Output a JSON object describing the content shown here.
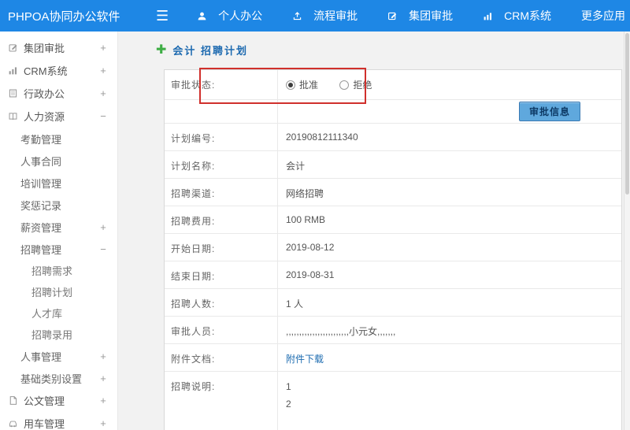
{
  "topbar": {
    "logo": "PHPOA协同办公软件",
    "menu_icon": "☰",
    "nav": [
      {
        "label": "个人办公"
      },
      {
        "label": "流程审批"
      },
      {
        "label": "集团审批"
      },
      {
        "label": "CRM系统"
      },
      {
        "label": "更多应用",
        "caret": "▾"
      }
    ]
  },
  "sidebar": {
    "items": [
      {
        "label": "集团审批",
        "toggle": "+"
      },
      {
        "label": "CRM系统",
        "toggle": "+"
      },
      {
        "label": "行政办公",
        "toggle": "+"
      },
      {
        "label": "人力资源",
        "toggle": "−",
        "children": [
          {
            "label": "考勤管理"
          },
          {
            "label": "人事合同"
          },
          {
            "label": "培训管理"
          },
          {
            "label": "奖惩记录"
          },
          {
            "label": "薪资管理",
            "toggle": "+"
          },
          {
            "label": "招聘管理",
            "toggle": "−",
            "children": [
              {
                "label": "招聘需求"
              },
              {
                "label": "招聘计划"
              },
              {
                "label": "人才库"
              },
              {
                "label": "招聘录用"
              }
            ]
          },
          {
            "label": "人事管理",
            "toggle": "+"
          },
          {
            "label": "基础类别设置",
            "toggle": "+"
          }
        ]
      },
      {
        "label": "公文管理",
        "toggle": "+"
      },
      {
        "label": "用车管理",
        "toggle": "+"
      }
    ]
  },
  "main": {
    "plus_icon": "✚",
    "title": "会计 招聘计划",
    "status_row": {
      "label": "审批状态:",
      "options": [
        {
          "label": "批准",
          "checked": true
        },
        {
          "label": "拒绝",
          "checked": false
        }
      ]
    },
    "approve_button": "审批信息",
    "rows": [
      {
        "label": "计划编号:",
        "value": "20190812111340"
      },
      {
        "label": "计划名称:",
        "value": "会计"
      },
      {
        "label": "招聘渠道:",
        "value": "网络招聘"
      },
      {
        "label": "招聘费用:",
        "value": "100 RMB"
      },
      {
        "label": "开始日期:",
        "value": "2019-08-12"
      },
      {
        "label": "结束日期:",
        "value": "2019-08-31"
      },
      {
        "label": "招聘人数:",
        "value": "1 人"
      },
      {
        "label": "审批人员:",
        "value": ",,,,,,,,,,,,,,,,,,,,,,,,小元女,,,,,,,"
      },
      {
        "label": "附件文档:",
        "link": "附件下载"
      },
      {
        "label": "招聘说明:",
        "lines": [
          "1",
          "2"
        ]
      }
    ]
  },
  "colors": {
    "topbar_bg": "#1e87e5",
    "title_blue": "#1d6ab0",
    "annotation_red": "#d0302c",
    "button_bg": "#5fa8dd",
    "link_blue": "#1c6bb0"
  }
}
